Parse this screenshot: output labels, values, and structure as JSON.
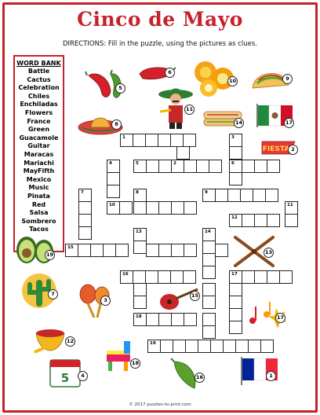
{
  "title": "Cinco de Mayo",
  "directions": "DIRECTIONS:  Fill in the puzzle, using the pictures as clues.",
  "word_bank": {
    "heading": "WORD BANK",
    "words": [
      "Battle",
      "Cactus",
      "Celebration",
      "Chiles",
      "Enchiladas",
      "Flowers",
      "France",
      "Green",
      "Guacamole",
      "Guitar",
      "Maracas",
      "Mariachi",
      "MayFifth",
      "Mexico",
      "Music",
      "Pinata",
      "Red",
      "Salsa",
      "Sombrero",
      "Tacos"
    ]
  },
  "banner_text": "FIESTA",
  "calendar_day": "5",
  "clue_badges": [
    "5",
    "6",
    "10",
    "9",
    "8",
    "11",
    "14",
    "17",
    "2",
    "19",
    "13",
    "7",
    "3",
    "15",
    "12",
    "18",
    "4",
    "16",
    "17",
    "1"
  ],
  "grid_numbers": [
    "1",
    "2",
    "3",
    "4",
    "5",
    "6",
    "7",
    "8",
    "9",
    "10",
    "11",
    "12",
    "13",
    "14",
    "15",
    "16",
    "17",
    "18",
    "19"
  ],
  "footer": "© 2017 puzzles-to-print.com"
}
